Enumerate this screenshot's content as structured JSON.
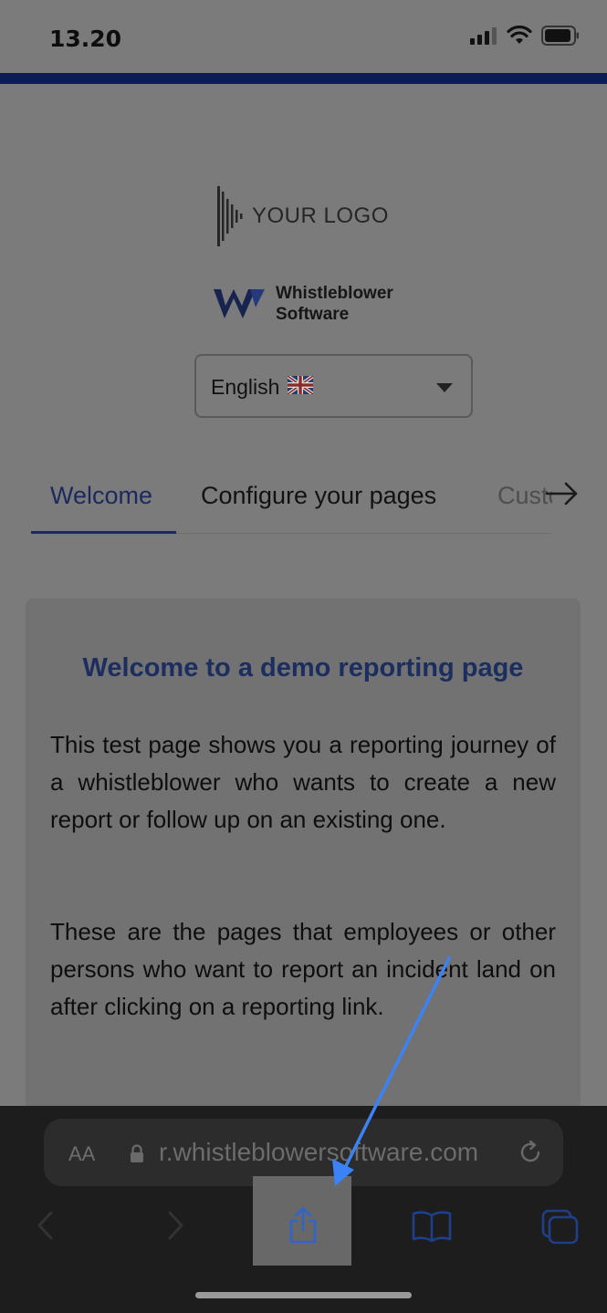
{
  "status_bar": {
    "time": "13.20"
  },
  "header": {
    "logo_text": "YOUR LOGO",
    "brand_line1": "Whistleblower",
    "brand_line2": "Software"
  },
  "language_select": {
    "selected": "English"
  },
  "tabs": [
    {
      "label": "Welcome",
      "active": true
    },
    {
      "label": "Configure your pages",
      "active": false
    },
    {
      "label": "Custo",
      "active": false
    }
  ],
  "card": {
    "title": "Welcome to a demo reporting page",
    "paragraph1": "This test page shows you a reporting journey of a whistleblower who wants to create a new report or follow up on an existing one.",
    "paragraph2": "These are the pages that employees or other persons who want to report an incident land on after clicking on a reporting link."
  },
  "browser": {
    "text_size_label": "AA",
    "url": "r.whistleblowersoftware.com"
  },
  "colors": {
    "accent": "#1b2a5e",
    "top_bar": "#0a1d55",
    "annotation_arrow": "#3b82f6"
  }
}
